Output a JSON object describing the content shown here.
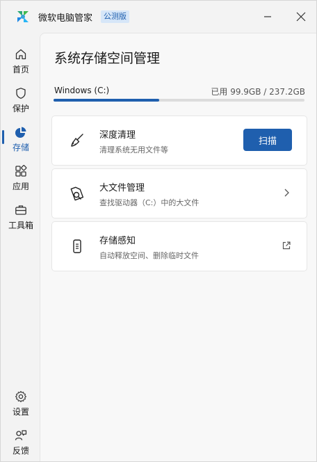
{
  "app": {
    "title": "微软电脑管家",
    "badge": "公测版"
  },
  "sidebar": {
    "items": [
      {
        "label": "首页",
        "icon": "home-icon"
      },
      {
        "label": "保护",
        "icon": "shield-icon"
      },
      {
        "label": "存储",
        "icon": "pie-chart-icon",
        "active": true
      },
      {
        "label": "应用",
        "icon": "apps-icon"
      },
      {
        "label": "工具箱",
        "icon": "toolbox-icon"
      }
    ],
    "bottom": [
      {
        "label": "设置",
        "icon": "gear-icon"
      },
      {
        "label": "反馈",
        "icon": "feedback-icon"
      }
    ]
  },
  "main": {
    "title": "系统存储空间管理",
    "drive": {
      "name": "Windows (C:)",
      "usage": "已用 99.9GB / 237.2GB",
      "used_fraction": 0.42
    },
    "cards": [
      {
        "title": "深度清理",
        "desc": "清理系统无用文件等",
        "button": "扫描",
        "icon": "broom-icon"
      },
      {
        "title": "大文件管理",
        "desc": "查找驱动器（C:）中的大文件",
        "icon": "file-search-icon"
      },
      {
        "title": "存储感知",
        "desc": "自动释放空间、删除临时文件",
        "icon": "phone-storage-icon"
      }
    ]
  },
  "colors": {
    "accent": "#1f5fae",
    "badge_bg": "#d6e6f8"
  }
}
